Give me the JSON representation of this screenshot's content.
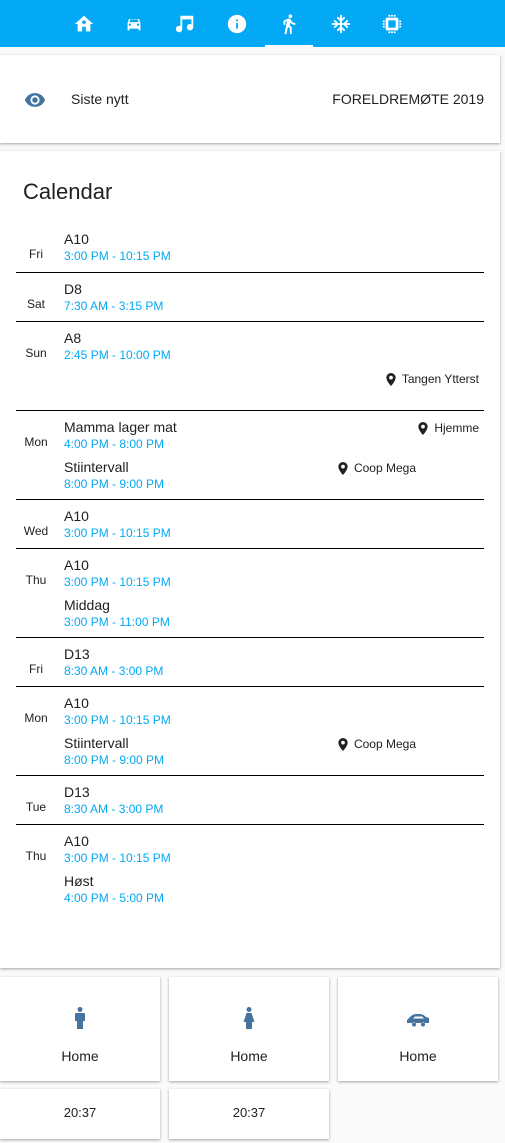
{
  "nav": {
    "tabs": [
      {
        "icon": "home-icon",
        "active": false
      },
      {
        "icon": "car-icon",
        "active": false
      },
      {
        "icon": "music-icon",
        "active": false
      },
      {
        "icon": "info-icon",
        "active": false
      },
      {
        "icon": "run-icon",
        "active": true
      },
      {
        "icon": "snowflake-icon",
        "active": false
      },
      {
        "icon": "chip-icon",
        "active": false
      }
    ],
    "bar_color": "#03a9f4"
  },
  "news": {
    "icon": "eye-icon",
    "label": "Siste nytt",
    "value": "FORELDREMØTE 2019"
  },
  "calendar": {
    "title": "Calendar",
    "days": [
      {
        "weekday": "Fri",
        "events": [
          {
            "title": "A10",
            "time": "3:00 PM - 10:15 PM"
          }
        ]
      },
      {
        "weekday": "Sat",
        "events": [
          {
            "title": "D8",
            "time": "7:30 AM - 3:15 PM"
          }
        ]
      },
      {
        "weekday": "Sun",
        "events": [
          {
            "title": "A8",
            "time": "2:45 PM - 10:00 PM",
            "location": "Tangen Ytterst"
          }
        ]
      },
      {
        "weekday": "Mon",
        "events": [
          {
            "title": "Mamma lager mat",
            "time": "4:00 PM - 8:00 PM",
            "location": "Hjemme"
          },
          {
            "title": "Stiintervall",
            "time": "8:00 PM - 9:00 PM",
            "location": "Coop Mega"
          }
        ]
      },
      {
        "weekday": "Wed",
        "events": [
          {
            "title": "A10",
            "time": "3:00 PM - 10:15 PM"
          }
        ]
      },
      {
        "weekday": "Thu",
        "events": [
          {
            "title": "A10",
            "time": "3:00 PM - 10:15 PM"
          },
          {
            "title": "Middag",
            "time": "3:00 PM - 11:00 PM"
          }
        ]
      },
      {
        "weekday": "Fri",
        "events": [
          {
            "title": "D13",
            "time": "8:30 AM - 3:00 PM"
          }
        ]
      },
      {
        "weekday": "Mon",
        "events": [
          {
            "title": "A10",
            "time": "3:00 PM - 10:15 PM"
          },
          {
            "title": "Stiintervall",
            "time": "8:00 PM - 9:00 PM",
            "location": "Coop Mega"
          }
        ]
      },
      {
        "weekday": "Tue",
        "events": [
          {
            "title": "D13",
            "time": "8:30 AM - 3:00 PM"
          }
        ]
      },
      {
        "weekday": "Thu",
        "events": [
          {
            "title": "A10",
            "time": "3:00 PM - 10:15 PM"
          },
          {
            "title": "Høst",
            "time": "4:00 PM - 5:00 PM"
          }
        ]
      }
    ]
  },
  "entities": [
    {
      "icon": "man-icon",
      "state": "Home"
    },
    {
      "icon": "woman-icon",
      "state": "Home"
    },
    {
      "icon": "car-icon",
      "state": "Home"
    }
  ],
  "clocks": [
    {
      "time": "20:37"
    },
    {
      "time": "20:37"
    }
  ],
  "colors": {
    "accent": "#03a9f4",
    "icon": "#44739e"
  }
}
